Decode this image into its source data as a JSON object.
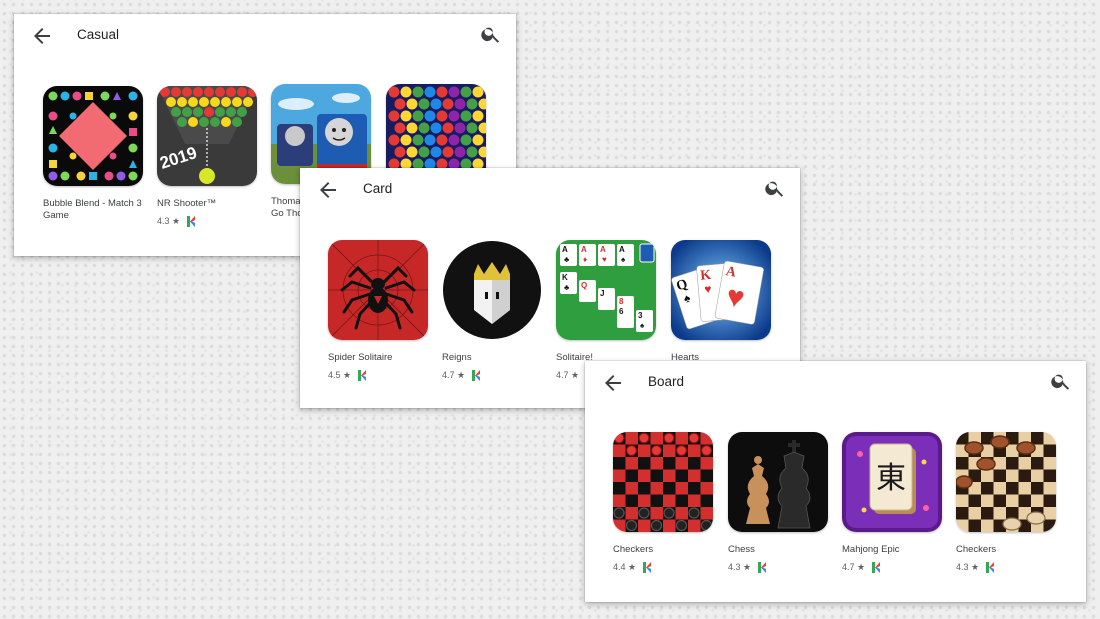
{
  "panels": [
    {
      "title": "Casual",
      "apps": [
        {
          "name": "Bubble Blend - Match 3 Game",
          "rating": ""
        },
        {
          "name": "NR Shooter™",
          "rating": "4.3 ★"
        },
        {
          "name": "Thomas & Friends: Go Go Thomas! On!",
          "rating": ""
        },
        {
          "name": "",
          "rating": ""
        }
      ]
    },
    {
      "title": "Card",
      "apps": [
        {
          "name": "Spider Solitaire",
          "rating": "4.5 ★"
        },
        {
          "name": "Reigns",
          "rating": "4.7 ★"
        },
        {
          "name": "Solitaire!",
          "rating": "4.7 ★"
        },
        {
          "name": "Hearts",
          "rating": ""
        }
      ]
    },
    {
      "title": "Board",
      "apps": [
        {
          "name": "Checkers",
          "rating": "4.4 ★"
        },
        {
          "name": "Chess",
          "rating": "4.3 ★"
        },
        {
          "name": "Mahjong Epic",
          "rating": "4.7 ★"
        },
        {
          "name": "Checkers",
          "rating": "4.3 ★"
        }
      ]
    }
  ],
  "icon_art": {
    "nr_shooter_year": "2019",
    "mahjong_tile_glyph": "東",
    "solitaire_cards": [
      "A",
      "A",
      "A",
      "A",
      "K",
      "Q",
      "J",
      "8",
      "6",
      "3"
    ],
    "hearts_cards": [
      "Q",
      "K",
      "A"
    ]
  },
  "icons": {
    "back": "arrow-left-icon",
    "search": "search-icon",
    "badge": "kids-badge-icon"
  },
  "colors": {
    "accent_green": "#34a853",
    "text_primary": "#202124",
    "text_secondary": "#5f6368"
  }
}
